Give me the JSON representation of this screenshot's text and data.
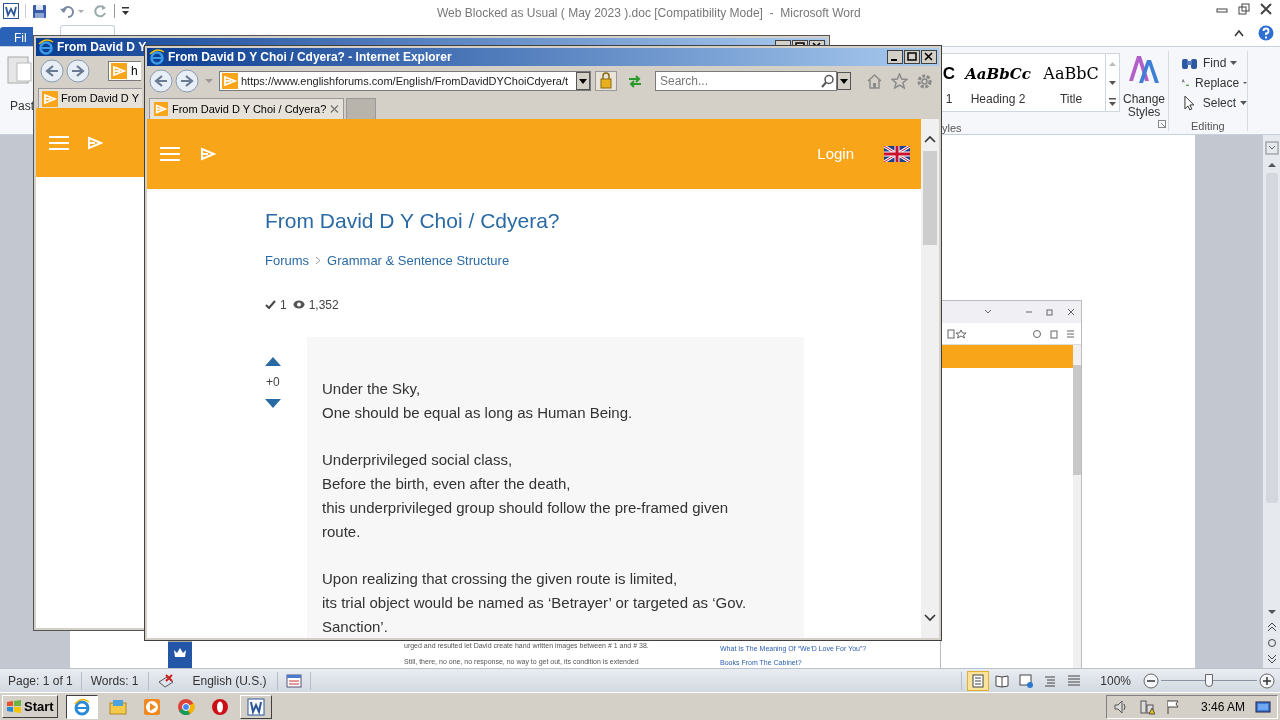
{
  "word": {
    "title": "Web Blocked as Usual ( May 2023 ).doc [Compatibility Mode]  -  Microsoft Word",
    "file_tab": "Fil",
    "paste_label": "Past",
    "styles": [
      {
        "sample": "C",
        "label": "1",
        "kind": "heading"
      },
      {
        "sample": "AaBbCc",
        "label": "Heading 2",
        "kind": "italic"
      },
      {
        "sample": "AaBbC",
        "label": "Title",
        "kind": "title"
      }
    ],
    "styles_group": "yles",
    "change_styles": "Change Styles",
    "editing": [
      {
        "label": "Find",
        "kind": "find"
      },
      {
        "label": "Replace",
        "kind": "replace"
      },
      {
        "label": "Select",
        "kind": "select"
      }
    ],
    "editing_group": "Editing",
    "document": {
      "lines": [
        "urged and resulted let David create hand written images between # 1 and # 38.",
        "Still, there, no one, no response, no way to get out, its condition is extended"
      ],
      "links": [
        "What Is The Meaning Of “We'D Love For You”?",
        "Books From The Cabinet?"
      ]
    },
    "status": [
      "Page: 1 of 1",
      "Words: 1",
      "English (U.S.)"
    ],
    "views": [
      {
        "selected": true
      },
      {
        "selected": false
      },
      {
        "selected": false
      },
      {
        "selected": false
      },
      {
        "selected": false
      }
    ],
    "zoom": {
      "reading": "100%",
      "level": 0.5
    }
  },
  "back_browser": {
    "title": "From David D Y",
    "address": "h",
    "tab": "From David D Y"
  },
  "browser": {
    "title": "From David D Y Choi / Cdyera? - Internet Explorer",
    "address": "https://www.englishforums.com/English/FromDavidDYChoiCdyera/t",
    "search": {
      "placeholder": "Search..."
    },
    "tab": "From David D Y Choi / Cdyera?",
    "site": {
      "login": "Login",
      "post_title": "From David D Y Choi / Cdyera?",
      "breadcrumbs": [
        "Forums",
        "Grammar & Sentence Structure"
      ],
      "answers": "1",
      "views": "1,352",
      "votes": "+0",
      "paragraphs": [
        [
          "Under the Sky,",
          "One should be equal as long as Human Being."
        ],
        [
          "Underprivileged social class,",
          "Before the birth, even after the death,",
          "this underprivileged group should follow the pre-framed given route."
        ],
        [
          "Upon realizing that crossing the given route is limited,",
          "its trial object would be named as ‘Betrayer’ or targeted as ‘Gov. Sanction’."
        ]
      ]
    }
  },
  "taskbar": {
    "start": "Start",
    "apps": [
      {
        "kind": "browser",
        "open": true,
        "selected": true
      },
      {
        "kind": "folder",
        "open": false,
        "selected": false
      },
      {
        "kind": "player",
        "open": false,
        "selected": false
      },
      {
        "kind": "chrome",
        "open": false,
        "selected": false
      },
      {
        "kind": "opera",
        "open": false,
        "selected": false
      },
      {
        "kind": "word",
        "open": true,
        "selected": false
      }
    ],
    "clock": "3:46 AM"
  }
}
